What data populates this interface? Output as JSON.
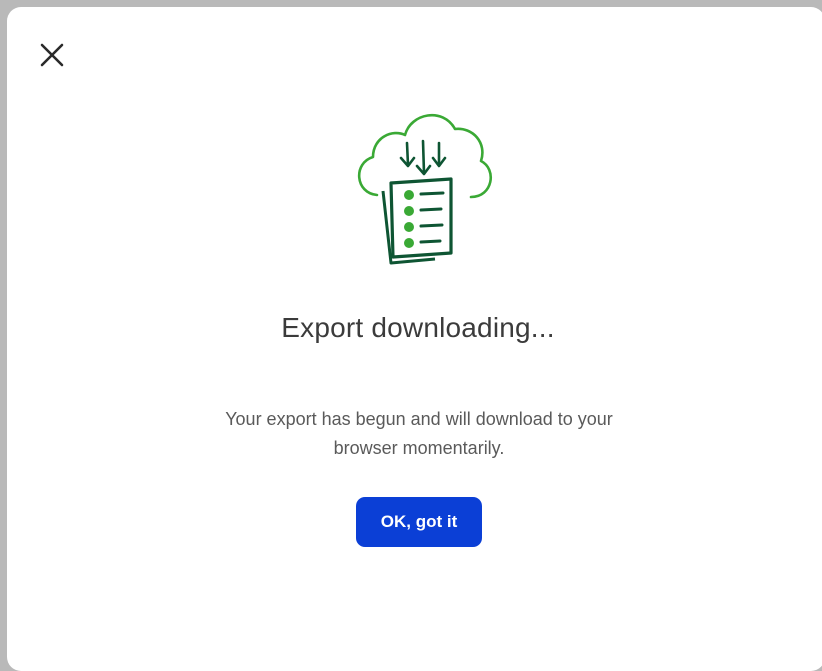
{
  "dialog": {
    "title": "Export downloading...",
    "message": "Your export has begun and will download to your browser momentarily.",
    "confirm_label": "OK, got it",
    "close_icon": "close-icon",
    "illustration_icon": "cloud-download-document-icon"
  },
  "colors": {
    "accent": "#0b3fd6",
    "illustration_green": "#3aa935",
    "illustration_dark_green": "#0e5533",
    "title_text": "#3b3b3b",
    "body_text": "#5a5a5a"
  }
}
